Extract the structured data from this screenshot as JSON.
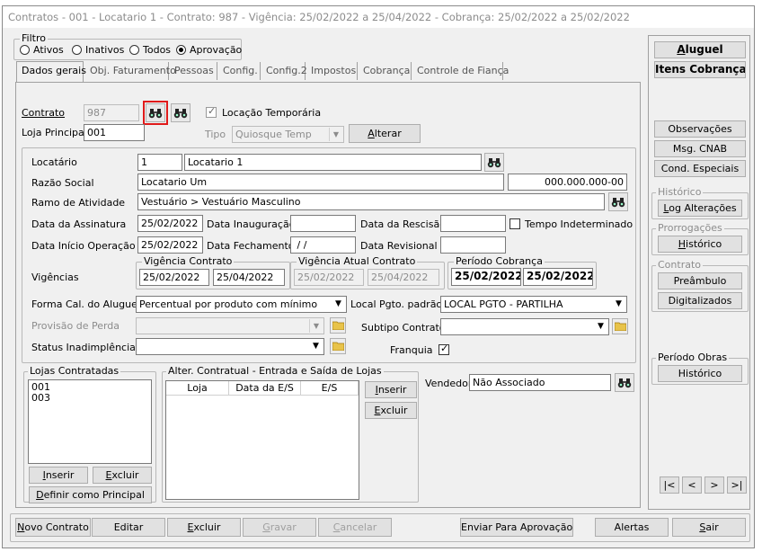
{
  "window": {
    "title": "Contratos - 001 - Locatario 1 - Contrato: 987 - Vigência: 25/02/2022 a 25/04/2022 - Cobrança: 25/02/2022 a 25/02/2022"
  },
  "filtro": {
    "legend": "Filtro",
    "options": [
      "Ativos",
      "Inativos",
      "Todos",
      "Aprovação"
    ],
    "selected": "Aprovação"
  },
  "tabs": [
    "Dados gerais",
    "Obj. Faturamento",
    "Pessoas",
    "Config.",
    "Config.2",
    "Impostos",
    "Cobrança",
    "Controle de Fiança"
  ],
  "active_tab": "Dados gerais",
  "contrato": {
    "label": "Contrato",
    "value": "987",
    "loja_label": "Loja Principal",
    "loja_value": "001",
    "locacao_temporaria_label": "Locação Temporária",
    "locacao_temporaria_checked": true,
    "tipo_label": "Tipo",
    "tipo_value": "Quiosque Temp",
    "alterar_label": "Alterar"
  },
  "locatario": {
    "label": "Locatário",
    "code": "1",
    "name": "Locatario 1",
    "razao_label": "Razão Social",
    "razao_value": "Locatario Um",
    "doc_value": "000.000.000-00",
    "ramo_label": "Ramo de Atividade",
    "ramo_value": "Vestuário > Vestuário Masculino"
  },
  "datas": {
    "assinatura_label": "Data da Assinatura",
    "assinatura_value": "25/02/2022",
    "inauguracao_label": "Data Inauguração",
    "inauguracao_value": "",
    "rescisao_label": "Data da Rescisão",
    "rescisao_value": "",
    "tempo_indeterminado_label": "Tempo Indeterminado",
    "tempo_indeterminado_checked": false,
    "inicio_label": "Data Início Operação",
    "inicio_value": "25/02/2022",
    "fechamento_label": "Data Fechamento",
    "fechamento_value": " / /",
    "revisional_label": "Data Revisional",
    "revisional_value": ""
  },
  "vigencias": {
    "label": "Vigências",
    "contrato_legend": "Vigência Contrato",
    "contrato_inicio": "25/02/2022",
    "contrato_fim": "25/04/2022",
    "atual_legend": "Vigência Atual Contrato",
    "atual_inicio": "25/02/2022",
    "atual_fim": "25/04/2022",
    "cobranca_legend": "Período Cobrança",
    "cobranca_inicio": "25/02/2022",
    "cobranca_fim": "25/02/2022"
  },
  "forma": {
    "label": "Forma Cal. do Aluguel",
    "value": "Percentual por produto com mínimo",
    "local_label": "Local Pgto. padrão",
    "local_value": "LOCAL PGTO - PARTILHA",
    "provisao_label": "Provisão de Perda",
    "provisao_value": "",
    "subtipo_label": "Subtipo Contrato",
    "subtipo_value": "",
    "status_label": "Status Inadimplência",
    "status_value": "",
    "franquia_label": "Franquia",
    "franquia_checked": true
  },
  "lojas": {
    "legend": "Lojas Contratadas",
    "items": [
      "001",
      "003"
    ],
    "inserir": "Inserir",
    "excluir": "Excluir",
    "definir": "Definir como Principal"
  },
  "alter": {
    "legend": "Alter. Contratual - Entrada e Saída de Lojas",
    "columns": [
      "Loja",
      "Data da E/S",
      "E/S"
    ],
    "inserir": "Inserir",
    "excluir": "Excluir"
  },
  "vendedor": {
    "label": "Vendedor",
    "value": "Não Associado"
  },
  "side": {
    "aluguel": "Aluguel",
    "itens_cobranca": "Itens Cobrança",
    "observacoes": "Observações",
    "msg_cnab": "Msg. CNAB",
    "cond_especiais": "Cond. Especiais",
    "historico_legend": "Histórico",
    "log_alteracoes": "Log Alterações",
    "prorrogacoes_legend": "Prorrogações",
    "prorrogacoes_historico": "Histórico",
    "contrato_legend": "Contrato",
    "preambulo": "Preâmbulo",
    "digitalizados": "Digitalizados",
    "periodo_obras_legend": "Período Obras",
    "periodo_obras_historico": "Histórico",
    "nav": [
      "|<",
      "<",
      ">",
      ">|"
    ]
  },
  "bottom": {
    "novo": "Novo Contrato",
    "editar": "Editar",
    "excluir": "Excluir",
    "gravar": "Gravar",
    "cancelar": "Cancelar",
    "enviar": "Enviar Para Aprovação",
    "alertas": "Alertas",
    "sair": "Sair"
  },
  "colors": {
    "highlight": "#e01a1a",
    "window_bg": "#f0f0f0",
    "disabled_text": "#8c8c8c"
  }
}
